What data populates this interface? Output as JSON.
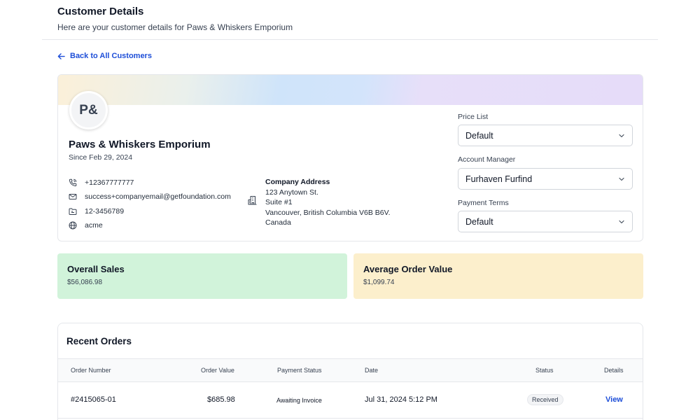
{
  "page": {
    "title": "Customer Details",
    "subtitle": "Here are your customer details for Paws & Whiskers Emporium"
  },
  "nav": {
    "back_label": "Back to All Customers",
    "back_icon": "arrow-left-icon"
  },
  "customer": {
    "initials": "P&",
    "name": "Paws & Whiskers Emporium",
    "since": "Since Feb 29, 2024",
    "phone": "+12367777777",
    "email": "success+companyemail@getfoundation.com",
    "tax_id": "12-3456789",
    "website": "acme",
    "address": {
      "title": "Company Address",
      "line1": "123 Anytown St.",
      "line2": "Suite #1",
      "line3": "Vancouver, British Columbia V6B B6V.",
      "line4": "Canada"
    }
  },
  "settings": {
    "price_list": {
      "label": "Price List",
      "value": "Default"
    },
    "account_manager": {
      "label": "Account Manager",
      "value": "Furhaven Furfind"
    },
    "payment_terms": {
      "label": "Payment Terms",
      "value": "Default"
    }
  },
  "stats": {
    "overall_sales": {
      "title": "Overall Sales",
      "value": "$56,086.98",
      "color": "#d1f3da"
    },
    "avg_order": {
      "title": "Average Order Value",
      "value": "$1,099.74",
      "color": "#fcefcc"
    }
  },
  "orders": {
    "title": "Recent Orders",
    "columns": [
      "Order Number",
      "Order Value",
      "Payment Status",
      "Date",
      "Status",
      "Details"
    ],
    "rows": [
      {
        "number": "#2415065-01",
        "value": "$685.98",
        "payment_status": "Awaiting Invoice",
        "date": "Jul 31, 2024 5:12 PM",
        "status": "Received",
        "details": "View"
      }
    ]
  },
  "colors": {
    "accent": "#1d4ed8",
    "border": "#e5e7eb"
  }
}
